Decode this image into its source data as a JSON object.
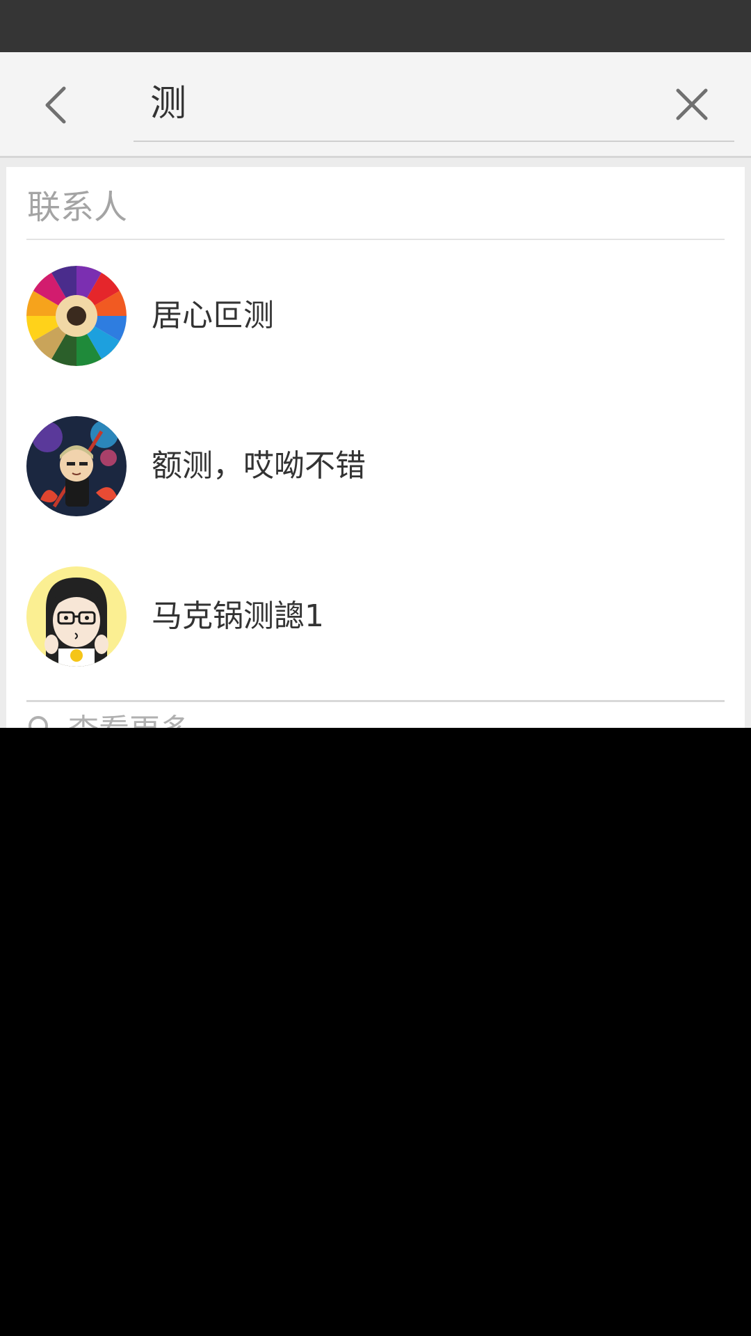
{
  "search": {
    "query": "测"
  },
  "contacts_section": {
    "title": "联系人",
    "items": [
      {
        "name": "居心叵测",
        "avatar": "colored-pencils-avatar"
      },
      {
        "name": "额测，哎呦不错",
        "avatar": "cartoon-warrior-avatar"
      },
      {
        "name": "马克锅测謥1",
        "avatar": "cartoon-girl-glasses-avatar"
      }
    ]
  },
  "more": {
    "label": "查看更多",
    "icon": "search-icon"
  },
  "icons": {
    "back": "back-arrow-icon",
    "clear": "close-icon"
  },
  "colors": {
    "status_bar": "#353535",
    "header_bg": "#f4f4f4",
    "card_bg": "#ffffff",
    "page_bg": "#ececec",
    "section_title": "#a4a4a4",
    "text_primary": "#333333",
    "icon": "#707070"
  }
}
